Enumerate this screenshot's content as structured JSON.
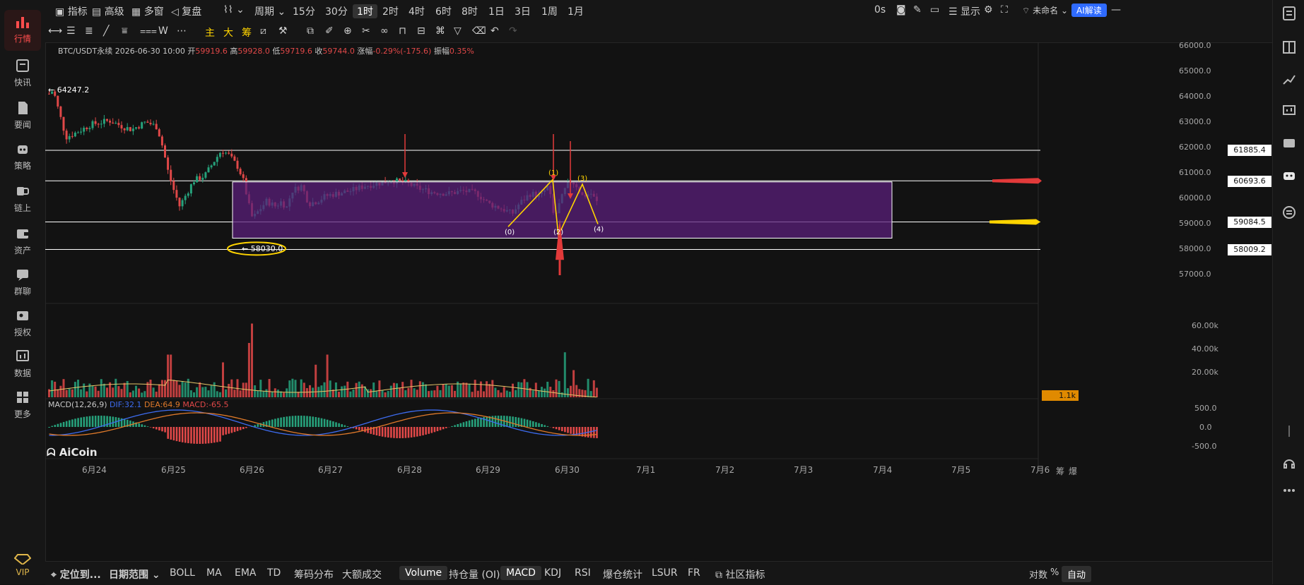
{
  "sidebar": {
    "items": [
      {
        "label": "行情",
        "icon": "bar-chart-icon"
      },
      {
        "label": "快讯",
        "icon": "news-icon"
      },
      {
        "label": "要闻",
        "icon": "document-icon"
      },
      {
        "label": "策略",
        "icon": "robot-icon"
      },
      {
        "label": "链上",
        "icon": "chain-icon"
      },
      {
        "label": "资产",
        "icon": "wallet-icon"
      },
      {
        "label": "群聊",
        "icon": "chat-icon"
      },
      {
        "label": "授权",
        "icon": "key-icon"
      },
      {
        "label": "数据",
        "icon": "data-icon"
      },
      {
        "label": "更多",
        "icon": "grid-icon"
      },
      {
        "label": "VIP",
        "icon": "diamond-icon"
      }
    ]
  },
  "topbar": {
    "indicator": "指标",
    "advanced": "高级",
    "multi": "多窗",
    "replay": "复盘",
    "period": "周期",
    "intervals": [
      "15分",
      "30分",
      "1时",
      "2时",
      "4时",
      "6时",
      "8时",
      "1日",
      "3日",
      "1周",
      "1月"
    ],
    "selected_interval": "1时",
    "timer": "0s",
    "display": "显示",
    "unnamed": "未命名",
    "ai": "AI解读"
  },
  "toolbar": {
    "items": [
      "主",
      "大",
      "筹",
      "W"
    ]
  },
  "info": {
    "symbol": "BTC/USDT永续",
    "time": "2026-06-30 10:00",
    "open_label": "开",
    "open": "59919.6",
    "high_label": "高",
    "high": "59928.0",
    "low_label": "低",
    "low": "59719.6",
    "close_label": "收",
    "close": "59744.0",
    "change_label": "涨幅",
    "change": "-0.29%(-175.6)",
    "amp_label": "振幅",
    "amp": "0.35%"
  },
  "price_axis": [
    "66000.0",
    "65000.0",
    "64000.0",
    "63000.0",
    "62000.0",
    "61000.0",
    "60000.0",
    "59000.0",
    "58000.0",
    "57000.0"
  ],
  "price_tags": [
    "61885.4",
    "60693.6",
    "59084.5",
    "58009.2"
  ],
  "annotations": {
    "high_mark": "64247.2",
    "low_mark": "58030.0",
    "waves": [
      "(0)",
      "(1)",
      "(2)",
      "(3)",
      "(4)"
    ]
  },
  "volume_axis": [
    "60.00k",
    "40.00k",
    "20.00k"
  ],
  "volume_tag": "1.1k",
  "macd": {
    "label": "MACD(12,26,9)",
    "dif": "DIF:32.1",
    "dea": "DEA:64.9",
    "macd": "MACD:-65.5",
    "axis": [
      "500.0",
      "0.0",
      "-500.0"
    ]
  },
  "x_axis": [
    "6月24",
    "6月25",
    "6月26",
    "6月27",
    "6月28",
    "6月29",
    "6月30",
    "7月1",
    "7月2",
    "7月3",
    "7月4",
    "7月5",
    "7月6"
  ],
  "axis_corner": [
    "筹",
    "爆"
  ],
  "logo": "AiCoin",
  "bottombar": {
    "locate": "定位到...",
    "range": "日期范围",
    "items": [
      "BOLL",
      "MA",
      "EMA",
      "TD",
      "筹码分布",
      "大额成交",
      "Volume",
      "持仓量 (OI)",
      "MACD",
      "KDJ",
      "RSI",
      "爆仓统计",
      "LSUR",
      "FR",
      "社区指标"
    ],
    "right": [
      "对数",
      "%",
      "自动"
    ]
  },
  "colors": {
    "up": "#26a17b",
    "down": "#e04848",
    "box": "#5a1f7a",
    "accent": "#ffd400"
  }
}
